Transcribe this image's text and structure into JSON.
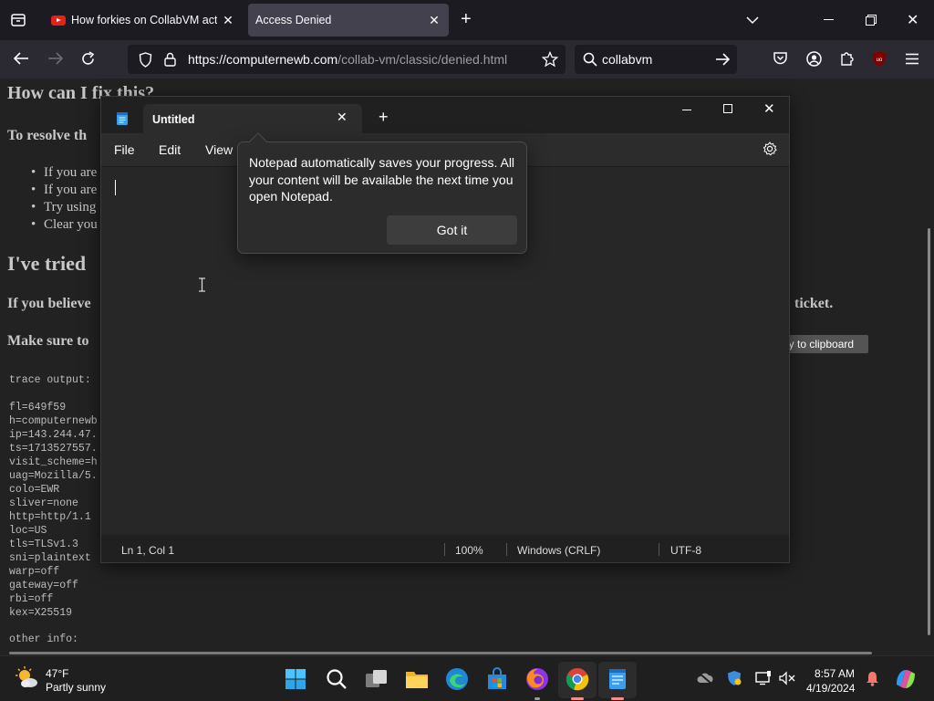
{
  "browser": {
    "tabs": [
      {
        "title": "How forkies on CollabVM act w",
        "active": false
      },
      {
        "title": "Access Denied",
        "active": true
      }
    ],
    "url": {
      "host": "https://computernewb.com",
      "path": "/collab-vm/classic/denied.html"
    },
    "search": {
      "value": "collabvm"
    },
    "colors": {
      "tabbar": "#1c1b22",
      "toolbar": "#2b2a33",
      "active_tab": "#42414d"
    }
  },
  "page": {
    "heading_fix": "How can I fix this?",
    "resolve_text": "To resolve th",
    "list_items": [
      "If you are",
      "If you are",
      "Try using",
      "Clear you"
    ],
    "heading_tried": "I've tried",
    "believe_text": "If you believe",
    "ticket_text": "ticket.",
    "make_sure_text": "Make sure to",
    "copy_button": "py to clipboard",
    "trace_label": "trace output:",
    "trace_lines": [
      "fl=649f59",
      "h=computernewb",
      "ip=143.244.47.",
      "ts=1713527557.",
      "visit_scheme=h",
      "uag=Mozilla/5.",
      "colo=EWR",
      "sliver=none",
      "http=http/1.1",
      "loc=US",
      "tls=TLSv1.3",
      "sni=plaintext",
      "warp=off",
      "gateway=off",
      "rbi=off",
      "kex=X25519"
    ],
    "other_info": "other info:"
  },
  "notepad": {
    "tab_title": "Untitled",
    "menu": {
      "file": "File",
      "edit": "Edit",
      "view": "View"
    },
    "popup": {
      "message": "Notepad automatically saves your progress. All your content will be available the next time you open Notepad.",
      "button": "Got it"
    },
    "status": {
      "position": "Ln 1, Col 1",
      "zoom": "100%",
      "line_ending": "Windows (CRLF)",
      "encoding": "UTF-8"
    }
  },
  "taskbar": {
    "weather": {
      "temp": "47°F",
      "desc": "Partly sunny"
    },
    "clock": {
      "time": "8:57 AM",
      "date": "4/19/2024"
    },
    "apps": [
      "start-icon",
      "search-icon",
      "task-view-icon",
      "file-explorer-icon",
      "edge-icon",
      "store-icon",
      "firefox-icon",
      "chrome-icon",
      "notepad-icon"
    ]
  }
}
